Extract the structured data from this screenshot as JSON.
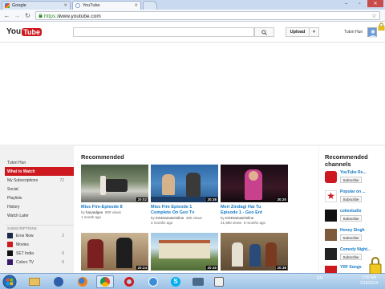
{
  "browser": {
    "tabs": [
      {
        "label": "Google",
        "favicon": "google-favicon"
      },
      {
        "label": "YouTube",
        "favicon": "youtube-favicon"
      }
    ],
    "url_scheme": "https://",
    "url_rest": "www.youtube.com"
  },
  "masthead": {
    "logo_you": "You",
    "logo_tube": "Tube",
    "upload_label": "Upload",
    "username": "Tutori Hun"
  },
  "guide": {
    "items": [
      {
        "label": "Tutori Hun"
      },
      {
        "label": "What to Watch"
      },
      {
        "label": "My Subscriptions",
        "count": "72"
      },
      {
        "label": "Social"
      },
      {
        "label": "Playlists"
      },
      {
        "label": "History"
      },
      {
        "label": "Watch Later"
      }
    ],
    "subscriptions_header": "SUBSCRIPTIONS",
    "subscriptions": [
      {
        "label": "Eros Now",
        "count": "2"
      },
      {
        "label": "Movies"
      },
      {
        "label": "SET India",
        "count": "6"
      },
      {
        "label": "Colors TV",
        "count": "6"
      }
    ]
  },
  "feed": {
    "title": "Recommended",
    "videos": [
      {
        "title_line1": "Miss Fire-Episode 8",
        "title_line2": "",
        "by": "by",
        "channel": "haryadgee",
        "views": "900 views",
        "age": "1 month ago",
        "duration": "20:02"
      },
      {
        "title_line1": "Miss Fire Episode 1",
        "title_line2": "Complete On Geo Tv",
        "by": "by",
        "channel": "KGDramasOnline",
        "views": "380 views",
        "age": "3 months ago",
        "duration": "20:38"
      },
      {
        "title_line1": "Meri Zindagi Hai Tu",
        "title_line2": "Episode 1 - Geo Ent",
        "by": "by",
        "channel": "KGDramasOnline",
        "views": "21,980 views",
        "age": "5 months ago",
        "duration": "20:20"
      },
      {
        "duration": "20:24"
      },
      {
        "duration": "20:45"
      },
      {
        "duration": "20:38"
      }
    ]
  },
  "channels": {
    "title_line1": "Recommended",
    "title_line2": "channels",
    "subscribe_label": "Subscribe",
    "items": [
      {
        "name": "YouTube Re..."
      },
      {
        "name": "Popular on ..."
      },
      {
        "name": "cokestudio"
      },
      {
        "name": "Honey Singh"
      },
      {
        "name": "Comedy Night..."
      },
      {
        "name": "YRF Songs"
      }
    ]
  },
  "taskbar": {
    "tray_lang": "EN",
    "time": "1:59 AM",
    "date": "2/18/2014"
  },
  "colors": {
    "accent_red": "#cc181e",
    "link_blue": "#167ac6"
  }
}
